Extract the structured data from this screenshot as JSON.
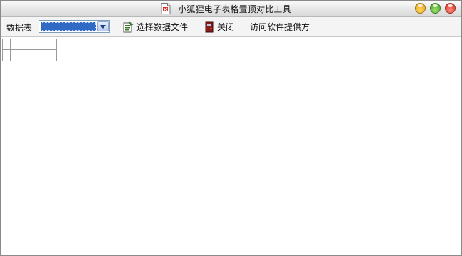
{
  "window": {
    "title": "小狐狸电子表格置顶对比工具",
    "icon": "app-sheet-icon",
    "controls": [
      "minimize-button",
      "maximize-button",
      "close-button"
    ]
  },
  "toolbar": {
    "sheet_label": "数据表",
    "sheet_select_value": "",
    "open_label": "选择数据文件",
    "close_label": "关闭",
    "visit_label": "访问软件提供方"
  },
  "colors": {
    "selection_blue": "#316ac5",
    "toolbar_bg": "#f4f4f4",
    "min_button": "#f3b02a",
    "max_button": "#5cb82f",
    "close_button": "#e2392a"
  },
  "grid": {
    "rows": [
      [
        ""
      ]
    ]
  }
}
